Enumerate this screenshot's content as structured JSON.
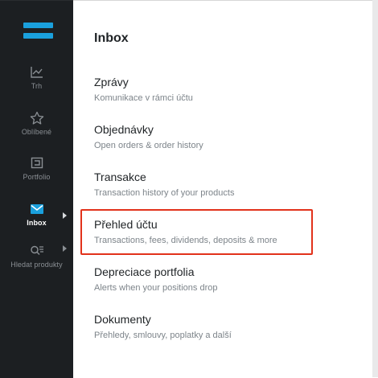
{
  "sidebar": {
    "accent_color": "#1aa0dd",
    "items": [
      {
        "icon": "chart-icon",
        "label": "Trh"
      },
      {
        "icon": "star-icon",
        "label": "Oblíbené"
      },
      {
        "icon": "portfolio-icon",
        "label": "Portfolio"
      },
      {
        "icon": "mail-icon",
        "label": "Inbox",
        "active": true
      },
      {
        "icon": "search-list-icon",
        "label": "Hledat produkty"
      }
    ]
  },
  "main": {
    "title": "Inbox",
    "items": [
      {
        "label": "Zprávy",
        "description": "Komunikace v rámci účtu"
      },
      {
        "label": "Objednávky",
        "description": "Open orders & order history"
      },
      {
        "label": "Transakce",
        "description": "Transaction history of your products"
      },
      {
        "label": "Přehled účtu",
        "description": "Transactions, fees, dividends, deposits & more",
        "highlighted": true
      },
      {
        "label": "Depreciace portfolia",
        "description": "Alerts when your positions drop"
      },
      {
        "label": "Dokumenty",
        "description": "Přehledy, smlouvy, poplatky a další"
      }
    ],
    "highlight_color": "#e2321b"
  }
}
